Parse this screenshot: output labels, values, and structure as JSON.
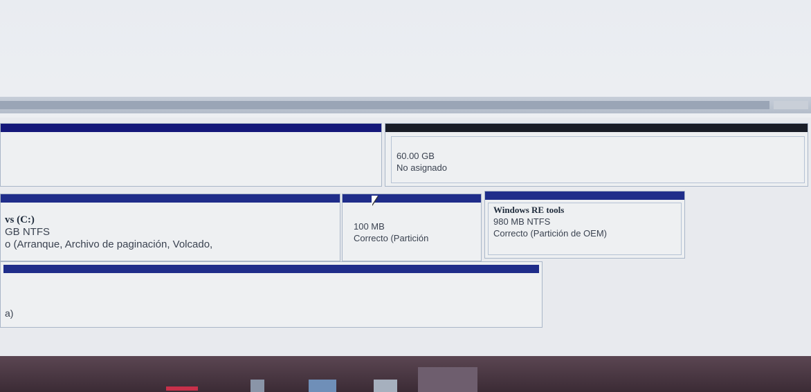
{
  "partitions": {
    "unallocated": {
      "size": "60.00 GB",
      "status": "No asignado"
    },
    "system_c": {
      "name": "vs  (C:)",
      "fs": "GB NTFS",
      "status": "o (Arranque, Archivo de paginación, Volcado,"
    },
    "reserved": {
      "size": "100 MB",
      "status": "Correcto (Partición"
    },
    "recovery": {
      "name": "Windows RE tools",
      "fs": "980 MB NTFS",
      "status": "Correcto (Partición de OEM)"
    },
    "lower": {
      "status": "a)"
    }
  },
  "colors": {
    "primary_stripe": "#1f2d8a",
    "unallocated_stripe": "#1a1d27",
    "taskbar": "#4a3843"
  }
}
